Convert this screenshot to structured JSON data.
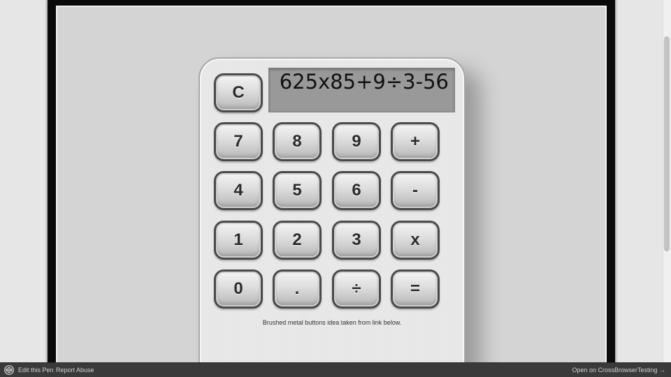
{
  "calculator": {
    "display_value": "625x85+9÷3-56",
    "keys": {
      "clear": "C",
      "seven": "7",
      "eight": "8",
      "nine": "9",
      "plus": "+",
      "four": "4",
      "five": "5",
      "six": "6",
      "minus": "-",
      "one": "1",
      "two": "2",
      "three": "3",
      "multiply": "x",
      "zero": "0",
      "decimal": ".",
      "divide": "÷",
      "equals": "="
    },
    "credit_text": "Brushed metal buttons idea taken from link below."
  },
  "footer": {
    "edit_label": "Edit this Pen",
    "report_label": "Report Abuse",
    "open_label": "Open on CrossBrowserTesting →"
  },
  "colors": {
    "frame": "#0b0b0b",
    "stage": "#d4d4d4",
    "display_bg": "#999999",
    "footer_bg": "#3a3a3a"
  },
  "icons": {
    "footer_logo": "codepen-icon"
  }
}
